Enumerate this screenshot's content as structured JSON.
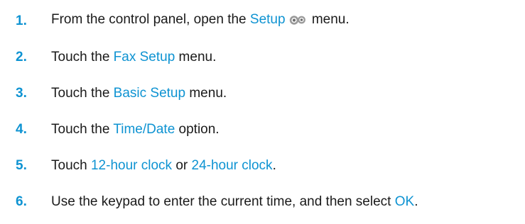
{
  "steps": [
    {
      "number": "1.",
      "parts": {
        "a": "From the control panel, open the ",
        "b": "Setup",
        "c": " menu."
      },
      "icon": "setup-gears-icon"
    },
    {
      "number": "2.",
      "parts": {
        "a": "Touch the ",
        "b": "Fax Setup",
        "c": " menu."
      }
    },
    {
      "number": "3.",
      "parts": {
        "a": "Touch the ",
        "b": "Basic Setup",
        "c": " menu."
      }
    },
    {
      "number": "4.",
      "parts": {
        "a": "Touch the ",
        "b": "Time/Date",
        "c": " option."
      }
    },
    {
      "number": "5.",
      "parts": {
        "a": "Touch ",
        "b": "12-hour clock",
        "c": " or ",
        "d": "24-hour clock",
        "e": "."
      }
    },
    {
      "number": "6.",
      "parts": {
        "a": "Use the keypad to enter the current time, and then select ",
        "b": "OK",
        "c": "."
      }
    }
  ],
  "colors": {
    "accent": "#0e93d2",
    "text": "#1a1a1a"
  }
}
